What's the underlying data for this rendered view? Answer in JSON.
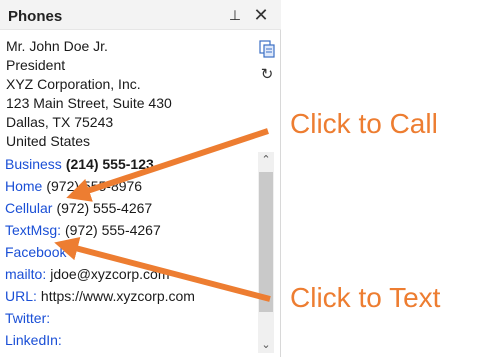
{
  "panel": {
    "title": "Phones",
    "pin_glyph": "⊥",
    "close_glyph": "✕"
  },
  "contact": {
    "lines": [
      "Mr. John Doe Jr.",
      "President",
      "XYZ Corporation, Inc.",
      "123 Main Street, Suite 430",
      "Dallas, TX 75243",
      "United States"
    ]
  },
  "icons": {
    "copy": "copy-icon",
    "rotate": "rotate-icon",
    "rotate_glyph": "↻"
  },
  "fields": [
    {
      "label": "Business",
      "value": "(214) 555-123",
      "bold": true
    },
    {
      "label": "Home",
      "value": "(972) 555-8976",
      "bold": false
    },
    {
      "label": "Cellular",
      "value": "(972) 555-4267",
      "bold": false
    },
    {
      "label": "TextMsg:",
      "value": "(972) 555-4267",
      "bold": false
    },
    {
      "label": "Facebook",
      "value": "",
      "bold": false
    },
    {
      "label": "mailto:",
      "value": "jdoe@xyzcorp.com",
      "bold": false
    },
    {
      "label": "URL:",
      "value": "https://www.xyzcorp.com",
      "bold": false
    },
    {
      "label": "Twitter:",
      "value": "",
      "bold": false
    },
    {
      "label": "LinkedIn:",
      "value": "",
      "bold": false
    }
  ],
  "scrollbar": {
    "up_glyph": "⌃",
    "down_glyph": "⌄"
  },
  "annotations": {
    "call_label": "Click to Call",
    "text_label": "Click to Text",
    "color": "#ed7d31"
  },
  "colors": {
    "link": "#1a4fd6",
    "annotation": "#ed7d31"
  }
}
